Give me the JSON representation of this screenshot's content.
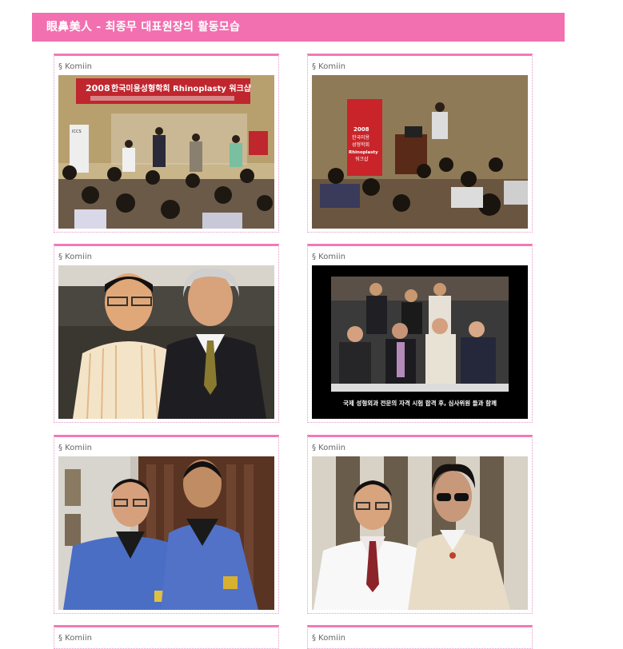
{
  "header": {
    "title": "眼鼻美人 - 최종무 대표원장의 활동모습"
  },
  "cards": [
    {
      "caption": "§ Komiin",
      "photo": "workshop-award-photo",
      "banner_year": "2008",
      "banner_text": "한국미용성형학회 Rhinoplasty 워크샵",
      "stand_text": "ICCS"
    },
    {
      "caption": "§ Komiin",
      "photo": "lecture-hall-photo",
      "banner_lines": [
        "2008",
        "한국미용",
        "성형학회",
        "Rhinoplasty",
        "워크샵"
      ]
    },
    {
      "caption": "§ Komiin",
      "photo": "two-men-portrait-photo"
    },
    {
      "caption": "§ Komiin",
      "photo": "group-photo",
      "photo_caption": "국제 성형외과 전문의 자격 시험 합격 후, 심사위원 들과 함께"
    },
    {
      "caption": "§ Komiin",
      "photo": "scrubs-photo"
    },
    {
      "caption": "§ Komiin",
      "photo": "white-coat-photo"
    },
    {
      "caption": "§ Komiin"
    },
    {
      "caption": "§ Komiin"
    }
  ]
}
